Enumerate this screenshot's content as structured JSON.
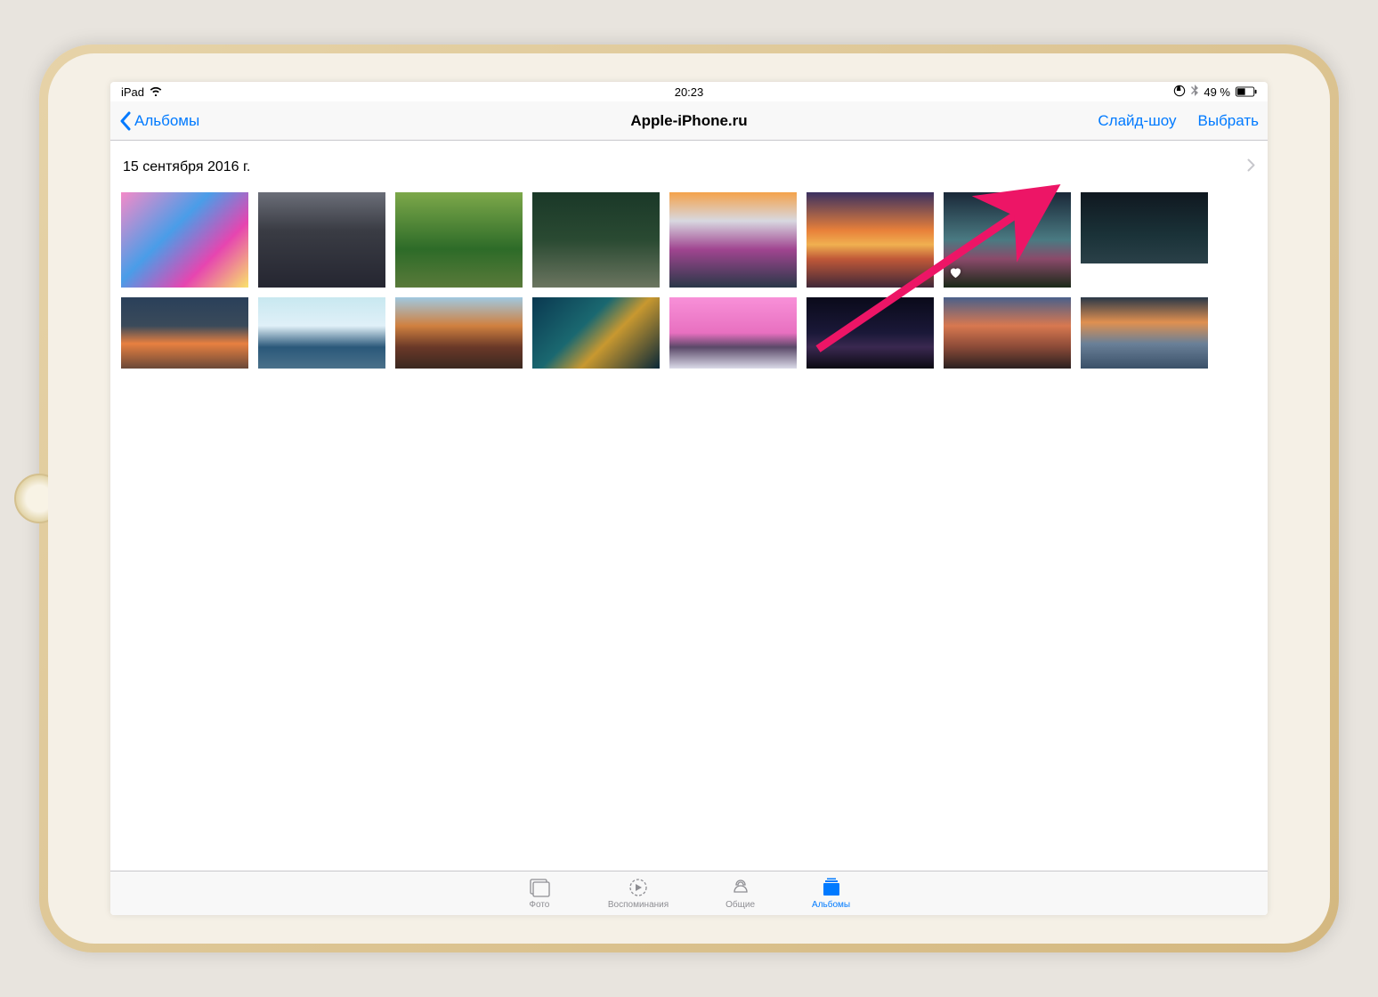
{
  "status_bar": {
    "device": "iPad",
    "time": "20:23",
    "battery_text": "49 %"
  },
  "nav": {
    "back_label": "Альбомы",
    "title": "Apple-iPhone.ru",
    "slideshow_label": "Слайд-шоу",
    "select_label": "Выбрать"
  },
  "section": {
    "date": "15 сентября 2016 г."
  },
  "photos": [
    {
      "favorite": false
    },
    {
      "favorite": false
    },
    {
      "favorite": false
    },
    {
      "favorite": false
    },
    {
      "favorite": false
    },
    {
      "favorite": false
    },
    {
      "favorite": true
    },
    {
      "favorite": false
    },
    {
      "favorite": false
    },
    {
      "favorite": false
    },
    {
      "favorite": false
    },
    {
      "favorite": false
    },
    {
      "favorite": false
    },
    {
      "favorite": false
    },
    {
      "favorite": false
    },
    {
      "favorite": false
    }
  ],
  "tabs": {
    "photos": "Фото",
    "memories": "Воспоминания",
    "shared": "Общие",
    "albums": "Альбомы"
  },
  "colors": {
    "accent": "#007aff",
    "annotation": "#ed1566"
  }
}
